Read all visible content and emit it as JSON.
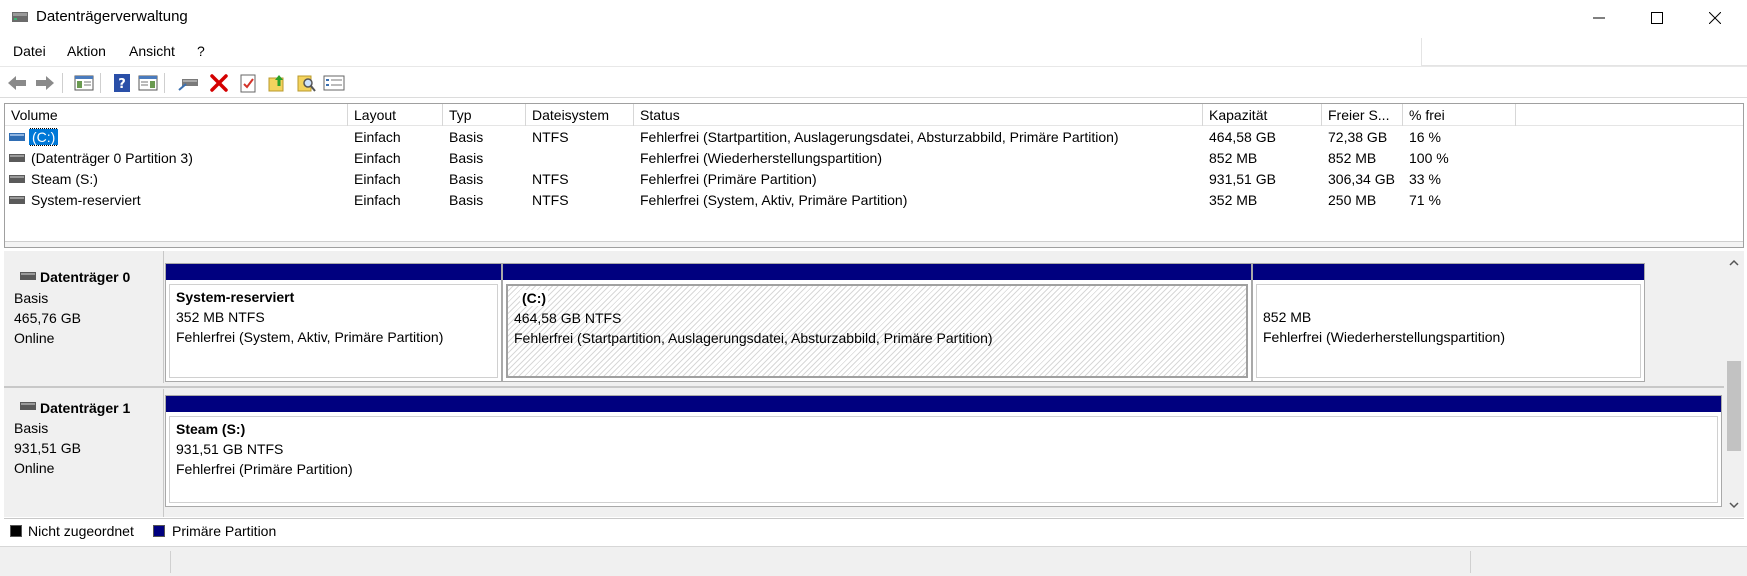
{
  "window": {
    "title": "Datenträgerverwaltung"
  },
  "menu": {
    "items": [
      "Datei",
      "Aktion",
      "Ansicht",
      "?"
    ]
  },
  "toolbar": {
    "icons": [
      "back-arrow-icon",
      "forward-arrow-icon",
      "console-tree-icon",
      "help-icon",
      "action-pane-icon",
      "connect-drive-icon",
      "delete-icon",
      "properties-icon",
      "up-folder-icon",
      "rescan-icon",
      "list-view-icon"
    ]
  },
  "volumes": {
    "columns": [
      "Volume",
      "Layout",
      "Typ",
      "Dateisystem",
      "Status",
      "Kapazität",
      "Freier S...",
      "% frei"
    ],
    "rows": [
      {
        "volume": "(C:)",
        "layout": "Einfach",
        "typ": "Basis",
        "fs": "NTFS",
        "status": "Fehlerfrei (Startpartition, Auslagerungsdatei, Absturzabbild, Primäre Partition)",
        "cap": "464,58 GB",
        "free": "72,38 GB",
        "pct": "16 %",
        "selected": true
      },
      {
        "volume": "(Datenträger 0 Partition 3)",
        "layout": "Einfach",
        "typ": "Basis",
        "fs": "",
        "status": "Fehlerfrei (Wiederherstellungspartition)",
        "cap": "852 MB",
        "free": "852 MB",
        "pct": "100 %",
        "selected": false
      },
      {
        "volume": "Steam (S:)",
        "layout": "Einfach",
        "typ": "Basis",
        "fs": "NTFS",
        "status": "Fehlerfrei (Primäre Partition)",
        "cap": "931,51 GB",
        "free": "306,34 GB",
        "pct": "33 %",
        "selected": false
      },
      {
        "volume": "System-reserviert",
        "layout": "Einfach",
        "typ": "Basis",
        "fs": "NTFS",
        "status": "Fehlerfrei (System, Aktiv, Primäre Partition)",
        "cap": "352 MB",
        "free": "250 MB",
        "pct": "71 %",
        "selected": false
      }
    ]
  },
  "disks": [
    {
      "name": "Datenträger 0",
      "type": "Basis",
      "size": "465,76 GB",
      "state": "Online",
      "partitions": [
        {
          "name": "System-reserviert",
          "size": "352 MB NTFS",
          "status": "Fehlerfrei (System, Aktiv, Primäre Partition)"
        },
        {
          "name": "(C:)",
          "size": "464,58 GB NTFS",
          "status": "Fehlerfrei (Startpartition, Auslagerungsdatei, Absturzabbild, Primäre Partition)"
        },
        {
          "name": "",
          "size": "852 MB",
          "status": "Fehlerfrei (Wiederherstellungspartition)"
        }
      ]
    },
    {
      "name": "Datenträger 1",
      "type": "Basis",
      "size": "931,51 GB",
      "state": "Online",
      "partitions": [
        {
          "name": "Steam  (S:)",
          "size": "931,51 GB NTFS",
          "status": "Fehlerfrei (Primäre Partition)"
        }
      ]
    }
  ],
  "legend": {
    "unallocated": "Nicht zugeordnet",
    "primary": "Primäre Partition",
    "unallocated_color": "#000000",
    "primary_color": "#00007f"
  },
  "colors": {
    "partition_bar": "#00007f",
    "selection": "#0078d7"
  }
}
